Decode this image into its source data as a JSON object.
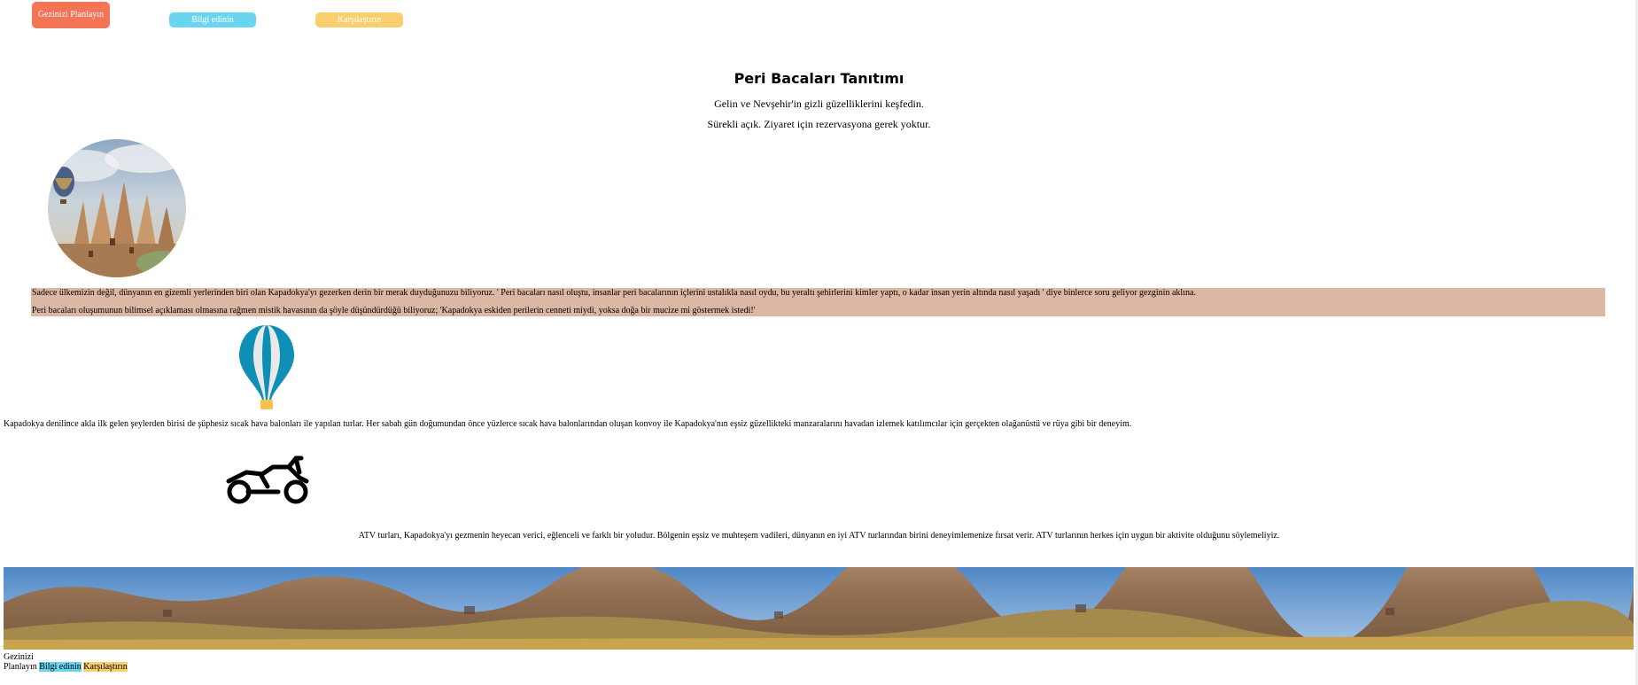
{
  "nav": {
    "plan_label": "Gezinizi Planlayın",
    "info_label": "Bilgi edinin",
    "compare_label": "Karşılaştırın",
    "colors": {
      "plan": "#f47456",
      "info": "#6ad5ee",
      "compare": "#f8cf6c"
    }
  },
  "header": {
    "title": "Peri Bacaları Tanıtımı",
    "subtitle": "Gelin ve Nevşehir'in gizli güzelliklerini keşfedin.",
    "hours": "Sürekli açık. Ziyaret için rezervasyona gerek yoktur."
  },
  "intro": {
    "paragraph1": "Sadece ülkemizin değil, dünyanın en gizemli yerlerinden biri olan Kapadokya'yı gezerken derin bir merak duyduğunuzu biliyoruz. ' Peri bacaları nasıl oluştu, insanlar peri bacalarının içlerini ustalıkla nasıl oydu, bu yeraltı şehirlerini kimler yaptı, o kadar insan yerin altında nasıl yaşadı ' diye binlerce soru geliyor gezginin aklına.",
    "paragraph2": "Peri bacaları oluşumunun bilimsel açıklaması olmasına rağmen mistik havasının da şöyle düşündürdüğü biliyoruz; 'Kapadokya eskiden perilerin cenneti miydi, yoksa doğa bir mucize mi göstermek istedi!'",
    "band_color": "#dcb7a4"
  },
  "balloon": {
    "icon": "hot-air-balloon-icon",
    "text": "Kapadokya denilince akla ilk gelen şeylerden birisi de şüphesiz sıcak hava balonları ile yapılan turlar. Her sabah gün doğumundan önce yüzlerce sıcak hava balonlarından oluşan konvoy ile Kapadokya'nın eşsiz güzellikteki manzaralarını havadan izlemek katılımcılar için gerçekten olağanüstü ve rüya gibi bir deneyim."
  },
  "atv": {
    "icon": "atv-icon",
    "text": "ATV turları, Kapadokya'yı gezmenin heyecan verici, eğlenceli ve farklı bir yoludur. Bölgenin eşsiz ve muhteşem vadileri, dünyanın en iyi ATV turlarından birini deneyimlemenize fırsat verir. ATV turlarının herkes için uygun bir aktivite olduğunu söylemeliyiz."
  },
  "footer": {
    "plan_line1": "Gezinizi",
    "plan_line2": "Planlayın",
    "info": "Bilgi edinin",
    "compare": "Karşılaştırın"
  }
}
